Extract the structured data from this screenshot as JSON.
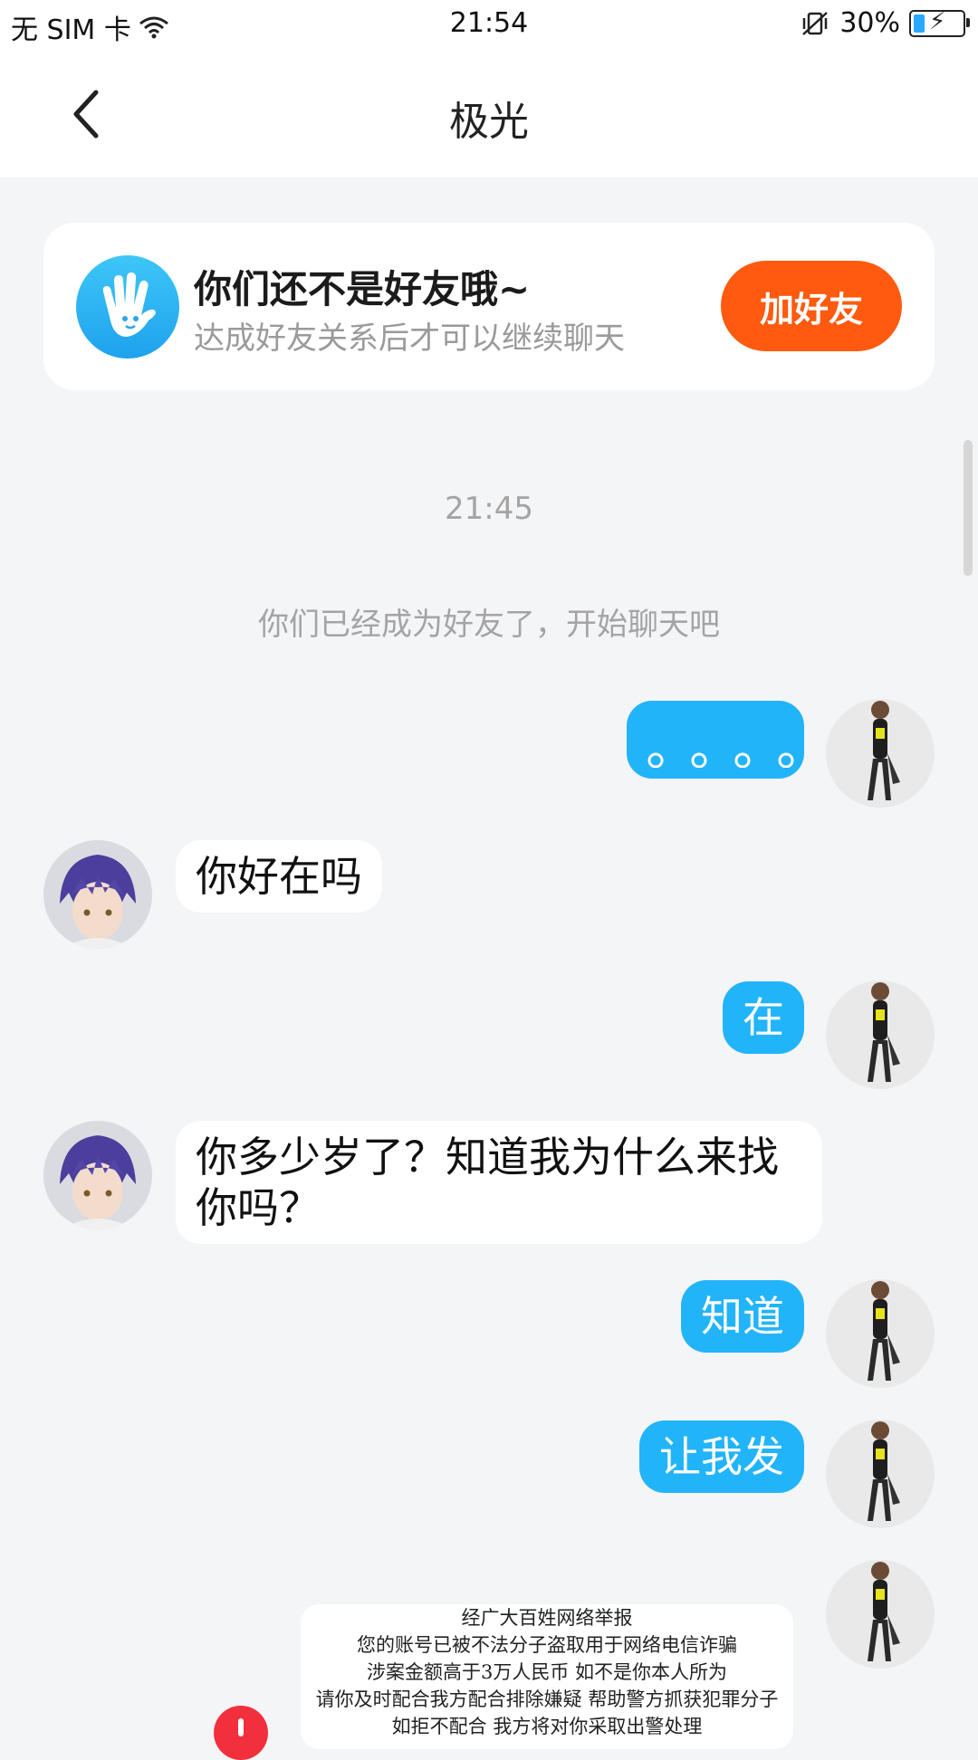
{
  "status_bar": {
    "carrier": "无 SIM 卡",
    "time": "21:54",
    "battery": "30%",
    "battery_level": 0.3,
    "icons": [
      "wifi-icon",
      "vibrate-mute-icon",
      "battery-charging-icon"
    ]
  },
  "nav": {
    "title": "极光",
    "back_icon": "chevron-left-icon"
  },
  "friend_notice": {
    "title": "你们还不是好友哦~",
    "subtitle": "达成好友关系后才可以继续聊天",
    "button": "加好友",
    "icon": "waving-hand-icon",
    "button_color": "#ff5a0f"
  },
  "chat": {
    "timestamp": "21:45",
    "system_message": "你们已经成为好友了，开始聊天吧",
    "messages": [
      {
        "from": "me",
        "text": "。。。。"
      },
      {
        "from": "peer",
        "text": "你好在吗"
      },
      {
        "from": "me",
        "text": "在"
      },
      {
        "from": "peer",
        "text": "你多少岁了？知道我为什么来找你吗？"
      },
      {
        "from": "me",
        "text": "知道"
      },
      {
        "from": "me",
        "text": "让我发"
      },
      {
        "from": "me",
        "type": "image",
        "lines": [
          "经广大百姓网络举报",
          "您的账号已被不法分子盗取用于网络电信诈骗",
          "涉案金额高于3万人民币 如不是你本人所为",
          "请你及时配合我方配合排除嫌疑 帮助警方抓获犯罪分子",
          "如拒不配合 我方将对你采取出警处理"
        ]
      }
    ]
  },
  "colors": {
    "my_bubble": "#22b4f9",
    "peer_bubble": "#ffffff",
    "background": "#f4f5f7",
    "error_badge": "#f2303d"
  }
}
